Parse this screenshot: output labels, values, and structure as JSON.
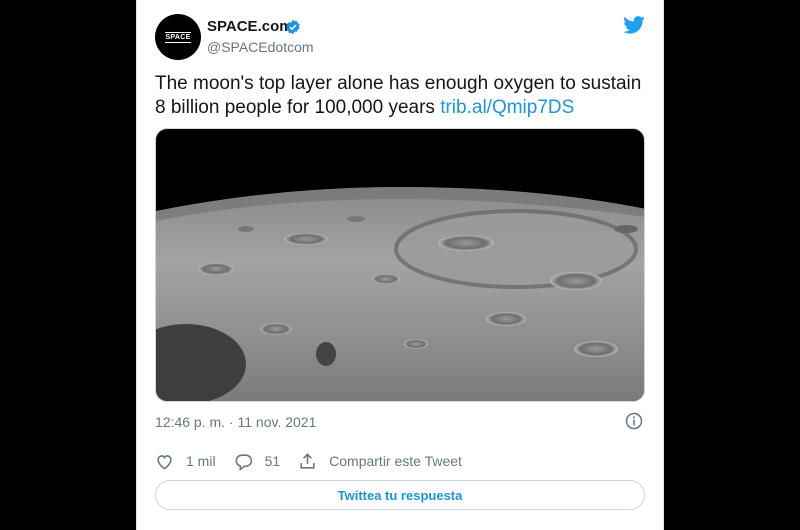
{
  "tweet": {
    "author": {
      "display_name": "SPACE.com",
      "handle": "@SPACEdotcom",
      "avatar_text": "SPACE",
      "verified": true
    },
    "text": "The moon's top layer alone has enough oxygen to sustain 8 billion people for 100,000 years ",
    "link": "trib.al/Qmip7DS",
    "media": {
      "description": "lunar surface with craters under black sky"
    },
    "timestamp": "12:46 p. m. · 11 nov. 2021",
    "actions": {
      "likes": "1 mil",
      "replies": "51",
      "share_label": "Compartir este Tweet"
    },
    "reply_button_label": "Twittea tu respuesta"
  },
  "colors": {
    "accent": "#1b95e0",
    "text": "#14171a",
    "muted": "#657786",
    "border": "#ccd6dd"
  },
  "icons": [
    "verified-badge-icon",
    "twitter-bird-icon",
    "info-icon",
    "heart-icon",
    "reply-icon",
    "share-icon"
  ]
}
